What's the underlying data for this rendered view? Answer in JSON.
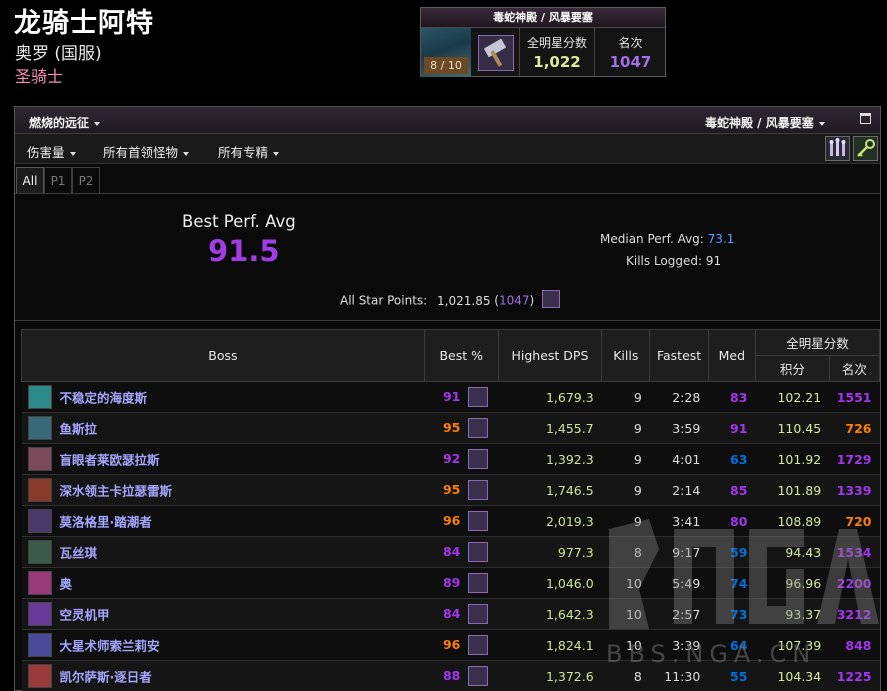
{
  "character": {
    "name": "龙骑士阿特",
    "realm": "奥罗 (国服)",
    "class": "圣骑士",
    "class_color": "#f48cba"
  },
  "raid_summary": {
    "title": "毒蛇神殿 / 风暴要塞",
    "progress": "8 / 10",
    "score_label": "全明星分数",
    "score": "1,022",
    "rank_label": "名次",
    "rank": "1047"
  },
  "filters": {
    "expansion": "燃烧的远征",
    "zone": "毒蛇神殿 / 风暴要塞",
    "metric": "伤害量",
    "bosses": "所有首领怪物",
    "specs": "所有专精"
  },
  "tabs": [
    "All",
    "P1",
    "P2"
  ],
  "summary": {
    "best_label": "Best Perf. Avg",
    "best_value": "91.5",
    "median_label": "Median Perf. Avg:",
    "median_value": "73.1",
    "kills_label": "Kills Logged:",
    "kills_value": "91",
    "allstar_label": "All Star Points:",
    "allstar_points": "1,021.85",
    "allstar_rank": "1047"
  },
  "table": {
    "headers": {
      "boss": "Boss",
      "best": "Best %",
      "dps": "Highest DPS",
      "kills": "Kills",
      "fastest": "Fastest",
      "med": "Med",
      "allstar": "全明星分数",
      "points": "积分",
      "rank": "名次"
    },
    "rows": [
      {
        "boss": "不稳定的海度斯",
        "best": "91",
        "best_color": "#a335ee",
        "dps": "1,679.3",
        "kills": "9",
        "fastest": "2:28",
        "med": "83",
        "med_color": "#a335ee",
        "points": "102.21",
        "rank": "1551",
        "rank_color": "#a335ee",
        "icon_color": "#2d8a8a"
      },
      {
        "boss": "鱼斯拉",
        "best": "95",
        "best_color": "#ff8000",
        "dps": "1,455.7",
        "kills": "9",
        "fastest": "3:59",
        "med": "91",
        "med_color": "#a335ee",
        "points": "110.45",
        "rank": "726",
        "rank_color": "#ff8000",
        "icon_color": "#3a6a7a"
      },
      {
        "boss": "盲眼者莱欧瑟拉斯",
        "best": "92",
        "best_color": "#a335ee",
        "dps": "1,392.3",
        "kills": "9",
        "fastest": "4:01",
        "med": "63",
        "med_color": "#0070dd",
        "points": "101.92",
        "rank": "1729",
        "rank_color": "#a335ee",
        "icon_color": "#7a4a5a"
      },
      {
        "boss": "深水领主卡拉瑟雷斯",
        "best": "95",
        "best_color": "#ff8000",
        "dps": "1,746.5",
        "kills": "9",
        "fastest": "2:14",
        "med": "85",
        "med_color": "#a335ee",
        "points": "101.89",
        "rank": "1339",
        "rank_color": "#a335ee",
        "icon_color": "#8a3a2a"
      },
      {
        "boss": "莫洛格里·踏潮者",
        "best": "96",
        "best_color": "#ff8000",
        "dps": "2,019.3",
        "kills": "9",
        "fastest": "3:41",
        "med": "80",
        "med_color": "#a335ee",
        "points": "108.89",
        "rank": "720",
        "rank_color": "#ff8000",
        "icon_color": "#4a3a6a"
      },
      {
        "boss": "瓦丝琪",
        "best": "84",
        "best_color": "#a335ee",
        "dps": "977.3",
        "kills": "8",
        "fastest": "9:17",
        "med": "59",
        "med_color": "#0070dd",
        "points": "94.43",
        "rank": "1534",
        "rank_color": "#a335ee",
        "icon_color": "#3a5a4a"
      },
      {
        "boss": "奥",
        "best": "89",
        "best_color": "#a335ee",
        "dps": "1,046.0",
        "kills": "10",
        "fastest": "5:49",
        "med": "74",
        "med_color": "#0070dd",
        "points": "96.96",
        "rank": "2200",
        "rank_color": "#a335ee",
        "icon_color": "#9a3a7a"
      },
      {
        "boss": "空灵机甲",
        "best": "84",
        "best_color": "#a335ee",
        "dps": "1,642.3",
        "kills": "10",
        "fastest": "2:57",
        "med": "73",
        "med_color": "#0070dd",
        "points": "93.37",
        "rank": "3212",
        "rank_color": "#a335ee",
        "icon_color": "#6a3a9a"
      },
      {
        "boss": "大星术师索兰莉安",
        "best": "96",
        "best_color": "#ff8000",
        "dps": "1,824.1",
        "kills": "10",
        "fastest": "3:39",
        "med": "64",
        "med_color": "#0070dd",
        "points": "107.39",
        "rank": "848",
        "rank_color": "#a335ee",
        "icon_color": "#4a4a9a"
      },
      {
        "boss": "凯尔萨斯·逐日者",
        "best": "88",
        "best_color": "#a335ee",
        "dps": "1,372.6",
        "kills": "8",
        "fastest": "11:30",
        "med": "55",
        "med_color": "#0070dd",
        "points": "104.34",
        "rank": "1225",
        "rank_color": "#a335ee",
        "icon_color": "#9a3a3a"
      }
    ]
  },
  "watermark": "BBS.NGA.CN"
}
